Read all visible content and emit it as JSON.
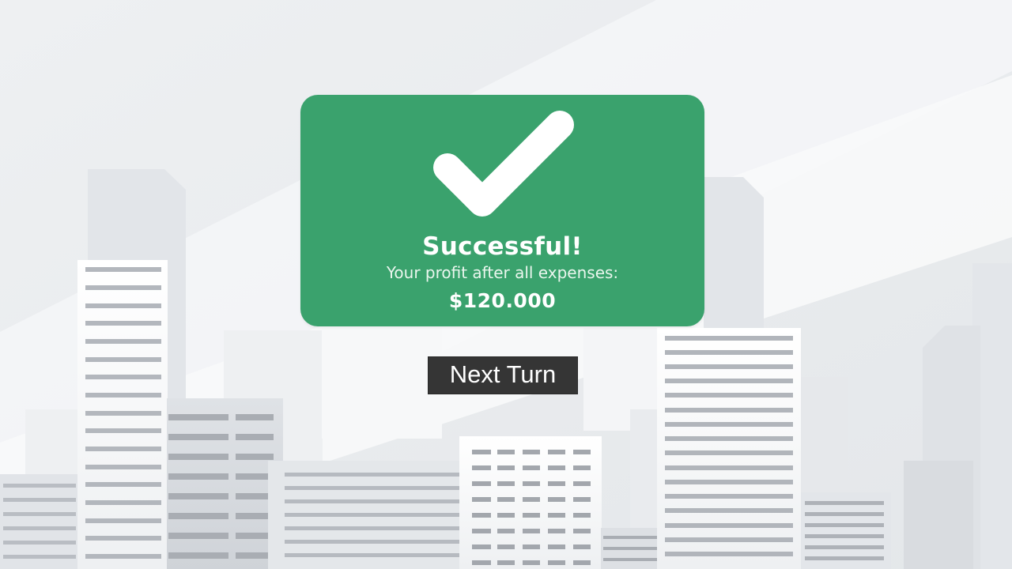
{
  "result": {
    "title": "Successful!",
    "subtitle": "Your profit after all expenses:",
    "amount": "$120.000"
  },
  "actions": {
    "next_turn_label": "Next Turn"
  },
  "colors": {
    "success_green": "#3aa26d",
    "button_dark": "#353535",
    "background": "#eceef1"
  },
  "icons": {
    "result_icon": "checkmark-icon"
  }
}
